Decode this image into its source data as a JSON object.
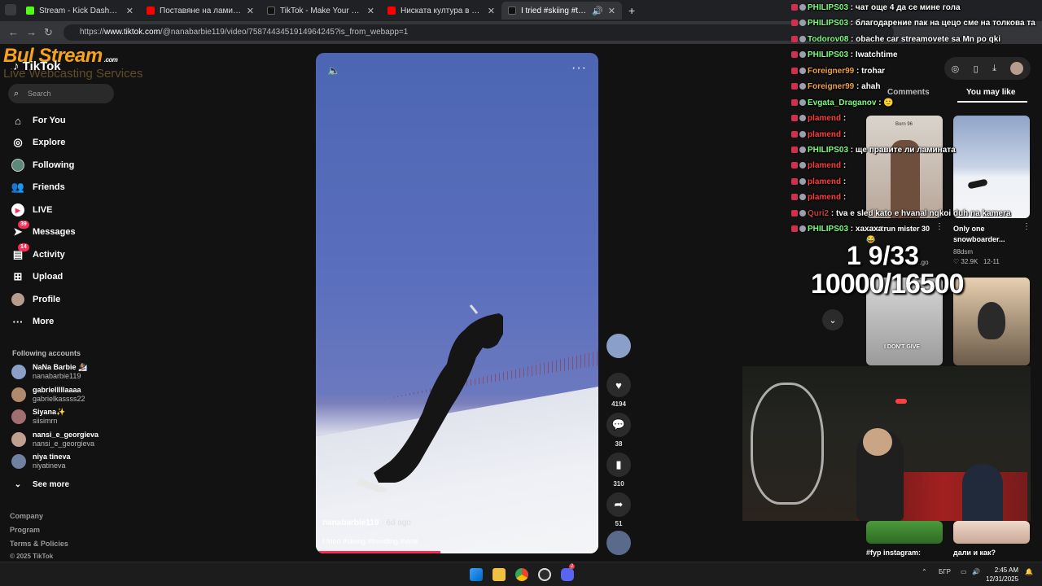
{
  "browser": {
    "tabs": [
      {
        "title": "Stream - Kick Dashboard",
        "fav_color": "#53fc18",
        "active": false
      },
      {
        "title": "Поставяне на ламиниран пар",
        "fav_color": "#ff0000",
        "active": false
      },
      {
        "title": "TikTok - Make Your Day",
        "fav_color": "#111111",
        "active": false
      },
      {
        "title": "Ниската култура в България -",
        "fav_color": "#ff0000",
        "active": false
      },
      {
        "title": "I tried #skiing #trending #",
        "fav_color": "#111111",
        "active": true
      }
    ],
    "new_tab": "+",
    "url_prefix": "https://",
    "url_host": "www.tiktok.com",
    "url_path": "/@nanabarbie119/video/7587443451914964245?is_from_webapp=1"
  },
  "overlay_logo": {
    "brand": "Bul",
    "brand2": "Stream",
    "com": ".com",
    "tagline": "Live Webcasting Services"
  },
  "sidebar": {
    "logo": "TikTok",
    "search_placeholder": "Search",
    "nav": [
      {
        "label": "For You",
        "icon": "home-icon"
      },
      {
        "label": "Explore",
        "icon": "compass-icon"
      },
      {
        "label": "Following",
        "icon": "following-icon"
      },
      {
        "label": "Friends",
        "icon": "friends-icon"
      },
      {
        "label": "LIVE",
        "icon": "live-icon"
      },
      {
        "label": "Messages",
        "icon": "messages-icon",
        "badge": "39"
      },
      {
        "label": "Activity",
        "icon": "activity-icon",
        "badge": "14"
      },
      {
        "label": "Upload",
        "icon": "upload-icon"
      },
      {
        "label": "Profile",
        "icon": "profile-icon"
      },
      {
        "label": "More",
        "icon": "more-icon"
      }
    ],
    "following_title": "Following accounts",
    "accounts": [
      {
        "name": "NaNa Barbie 🏂",
        "handle": "nanabarbie119",
        "color": "#8aa0c8"
      },
      {
        "name": "gabrielllllaaaa",
        "handle": "gabrielkassss22",
        "color": "#b08a6a"
      },
      {
        "name": "Siyana✨",
        "handle": "siisimrn",
        "color": "#a07070"
      },
      {
        "name": "nansi_e_georgieva",
        "handle": "nansi_e_georgieva",
        "color": "#c0a090"
      },
      {
        "name": "niya tineva",
        "handle": "niyatineva",
        "color": "#7080a0"
      }
    ],
    "see_more": "See more",
    "footer": [
      "Company",
      "Program",
      "Terms & Policies",
      "© 2025 TikTok"
    ]
  },
  "video": {
    "author": "nanabarbie119",
    "age": "· 6d ago",
    "caption": "I tried #skiing #trending #viral",
    "progress": 0.44,
    "actions": [
      {
        "icon": "heart-icon",
        "count": "4194"
      },
      {
        "icon": "comment-icon",
        "count": "38"
      },
      {
        "icon": "bookmark-icon",
        "count": "310"
      },
      {
        "icon": "share-icon",
        "count": "51"
      }
    ]
  },
  "right_rail": {
    "tabs": [
      "Comments",
      "You may like"
    ],
    "items": [
      {
        "caption": "...outrun mister 30 😂",
        "author": "",
        "likes": "",
        "date": "...go",
        "tag": "Born 96"
      },
      {
        "caption": "Only one snowboarder...",
        "author": "88dsm",
        "likes": "32.9K",
        "date": "12-11"
      },
      {
        "caption": "#fyp instagram:",
        "author": "",
        "likes": "",
        "date": "",
        "tag": "I DON'T GIVE"
      },
      {
        "caption": "дали и как?",
        "author": "",
        "likes": "",
        "date": ""
      }
    ]
  },
  "chat": [
    {
      "user": "PHILIPS03",
      "color": "#7cfc7c",
      "msg": "чат още 4 да се мине гола"
    },
    {
      "user": "PHILIPS03",
      "color": "#7cfc7c",
      "msg": "благодарение пак на цецо сме на толкова та"
    },
    {
      "user": "Todorov08",
      "color": "#7cfc7c",
      "msg": "obache car streamovete sa Mn po qki"
    },
    {
      "user": "PHILIPS03",
      "color": "#7cfc7c",
      "msg": "Iwatchtime"
    },
    {
      "user": "Foreigner99",
      "color": "#f0a040",
      "msg": "trohar"
    },
    {
      "user": "Foreigner99",
      "color": "#f0a040",
      "msg": "ahah"
    },
    {
      "user": "Evgata_Draganov",
      "color": "#7cfc7c",
      "msg": "🙂"
    },
    {
      "user": "plamend",
      "color": "#ff3b3b",
      "msg": ""
    },
    {
      "user": "plamend",
      "color": "#ff3b3b",
      "msg": ""
    },
    {
      "user": "PHILIPS03",
      "color": "#7cfc7c",
      "msg": "ще правите ли ламината"
    },
    {
      "user": "plamend",
      "color": "#ff3b3b",
      "msg": ""
    },
    {
      "user": "plamend",
      "color": "#ff3b3b",
      "msg": ""
    },
    {
      "user": "plamend",
      "color": "#ff3b3b",
      "msg": ""
    },
    {
      "user": "Quri2",
      "color": "#c04040",
      "msg": "tva e sled kato e hvanal nqkoi duh na kamera"
    },
    {
      "user": "PHILIPS03",
      "color": "#7cfc7c",
      "msg": "хахаха"
    }
  ],
  "counters": {
    "line1": "1 9/33",
    "line2": "10000/16500"
  },
  "taskbar": {
    "lang": "БГР",
    "time": "2:45 AM",
    "date": "12/31/2025",
    "discord_badge": "2"
  },
  "colors": {
    "accent": "#fe2c55",
    "bg": "#121212",
    "brand": "#f6a21c"
  }
}
